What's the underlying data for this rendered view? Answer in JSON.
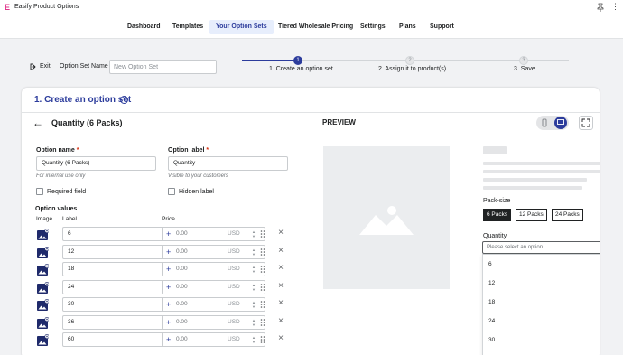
{
  "window": {
    "title": "Easify Product Options",
    "logo_glyph": "E",
    "pin_icon": "pin-icon",
    "more_icon": "more-vertical-icon"
  },
  "nav": {
    "tabs": [
      {
        "label": "Dashboard",
        "active": false
      },
      {
        "label": "Templates",
        "active": false
      },
      {
        "label": "Your Option Sets",
        "active": true
      },
      {
        "label": "Tiered Wholesale Pricing",
        "active": false
      },
      {
        "label": "Settings",
        "active": false
      },
      {
        "label": "Plans",
        "active": false
      },
      {
        "label": "Support",
        "active": false
      }
    ]
  },
  "toolbar": {
    "exit_label": "Exit",
    "set_name_label": "Option Set Name",
    "set_name_value": "",
    "set_name_placeholder": "New Option Set"
  },
  "steps": [
    {
      "number": "1",
      "label": "1. Create an option set",
      "active": true
    },
    {
      "number": "2",
      "label": "2. Assign it to product(s)",
      "active": false
    },
    {
      "number": "3",
      "label": "3. Save",
      "active": false
    }
  ],
  "card": {
    "title": "1. Create an option set",
    "help_glyph": "?"
  },
  "option": {
    "heading": "Quantity (6 Packs)",
    "name_label": "Option name",
    "name_value": "Quantity (6 Packs)",
    "name_help": "For internal use only",
    "label_label": "Option label",
    "label_value": "Quantity",
    "label_help": "Visible to your customers",
    "required_star": "*",
    "required_field_label": "Required field",
    "hidden_label_label": "Hidden label",
    "values_heading": "Option values",
    "col_image": "Image",
    "col_label": "Label",
    "col_price": "Price",
    "price_placeholder": "0.00",
    "currency": "USD",
    "values": [
      "6",
      "12",
      "18",
      "24",
      "30",
      "36",
      "60"
    ]
  },
  "preview": {
    "title": "PREVIEW",
    "pack_size_label": "Pack-size",
    "packs": [
      {
        "label": "6 Packs",
        "selected": true
      },
      {
        "label": "12 Packs",
        "selected": false
      },
      {
        "label": "24 Packs",
        "selected": false
      }
    ],
    "quantity_label": "Quantity",
    "select_placeholder": "Please select an option",
    "dropdown_options": [
      "6",
      "12",
      "18",
      "24",
      "30"
    ]
  },
  "colors": {
    "accent": "#2c3c9c",
    "brand_pink": "#e0338a",
    "required": "#d72c0d"
  }
}
